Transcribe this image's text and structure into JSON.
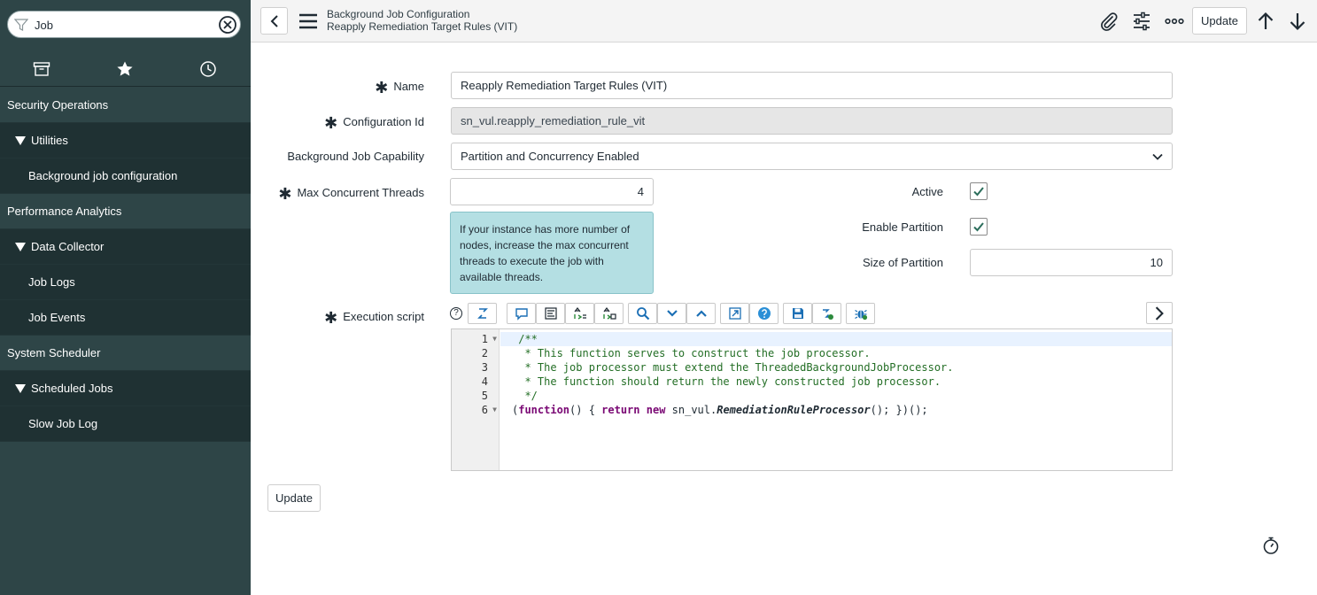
{
  "sidebar": {
    "filter_value": "Job",
    "tabs": [
      {
        "icon": "archive-icon"
      },
      {
        "icon": "star-icon"
      },
      {
        "icon": "clock-icon"
      }
    ],
    "items": [
      {
        "type": "app",
        "label": "Security Operations"
      },
      {
        "type": "section",
        "label": "Utilities"
      },
      {
        "type": "module",
        "label": "Background job configuration"
      },
      {
        "type": "app",
        "label": "Performance Analytics"
      },
      {
        "type": "section",
        "label": "Data Collector"
      },
      {
        "type": "module",
        "label": "Job Logs"
      },
      {
        "type": "module",
        "label": "Job Events"
      },
      {
        "type": "app",
        "label": "System Scheduler"
      },
      {
        "type": "section",
        "label": "Scheduled Jobs"
      },
      {
        "type": "module",
        "label": "Slow Job Log"
      }
    ]
  },
  "header": {
    "table_label": "Background Job Configuration",
    "record_label": "Reapply Remediation Target Rules (VIT)",
    "update_label": "Update"
  },
  "form": {
    "name_label": "Name",
    "name_value": "Reapply Remediation Target Rules (VIT)",
    "config_id_label": "Configuration Id",
    "config_id_value": "sn_vul.reapply_remediation_rule_vit",
    "capability_label": "Background Job Capability",
    "capability_value": "Partition and Concurrency Enabled",
    "max_threads_label": "Max Concurrent Threads",
    "max_threads_value": "4",
    "active_label": "Active",
    "active_checked": true,
    "enable_partition_label": "Enable Partition",
    "enable_partition_checked": true,
    "partition_size_label": "Size of Partition",
    "partition_size_value": "10",
    "hint_text": "If your instance has more number of nodes, increase the max concurrent threads to execute the job with available threads.",
    "script_label": "Execution script",
    "help_glyph": "?",
    "script_lines": [
      {
        "n": "1",
        "fold": true
      },
      {
        "n": "2",
        "fold": false
      },
      {
        "n": "3",
        "fold": false
      },
      {
        "n": "4",
        "fold": false
      },
      {
        "n": "5",
        "fold": false
      },
      {
        "n": "6",
        "fold": true
      }
    ],
    "code": {
      "l1": " /**",
      "l2": "  * This function serves to construct the job processor.",
      "l3": "  * The job processor must extend the ThreadedBackgroundJobProcessor.",
      "l4": "  * The function should return the newly constructed job processor.",
      "l5": "  */",
      "l6_open": "(",
      "l6_kw1": "function",
      "l6_mid": "() { ",
      "l6_kw2": "return",
      "l6_sp": " ",
      "l6_kw3": "new",
      "l6_ns": " sn_vul.",
      "l6_cls": "RemediationRuleProcessor",
      "l6_end": "(); })();"
    }
  },
  "footer": {
    "update_label": "Update"
  }
}
